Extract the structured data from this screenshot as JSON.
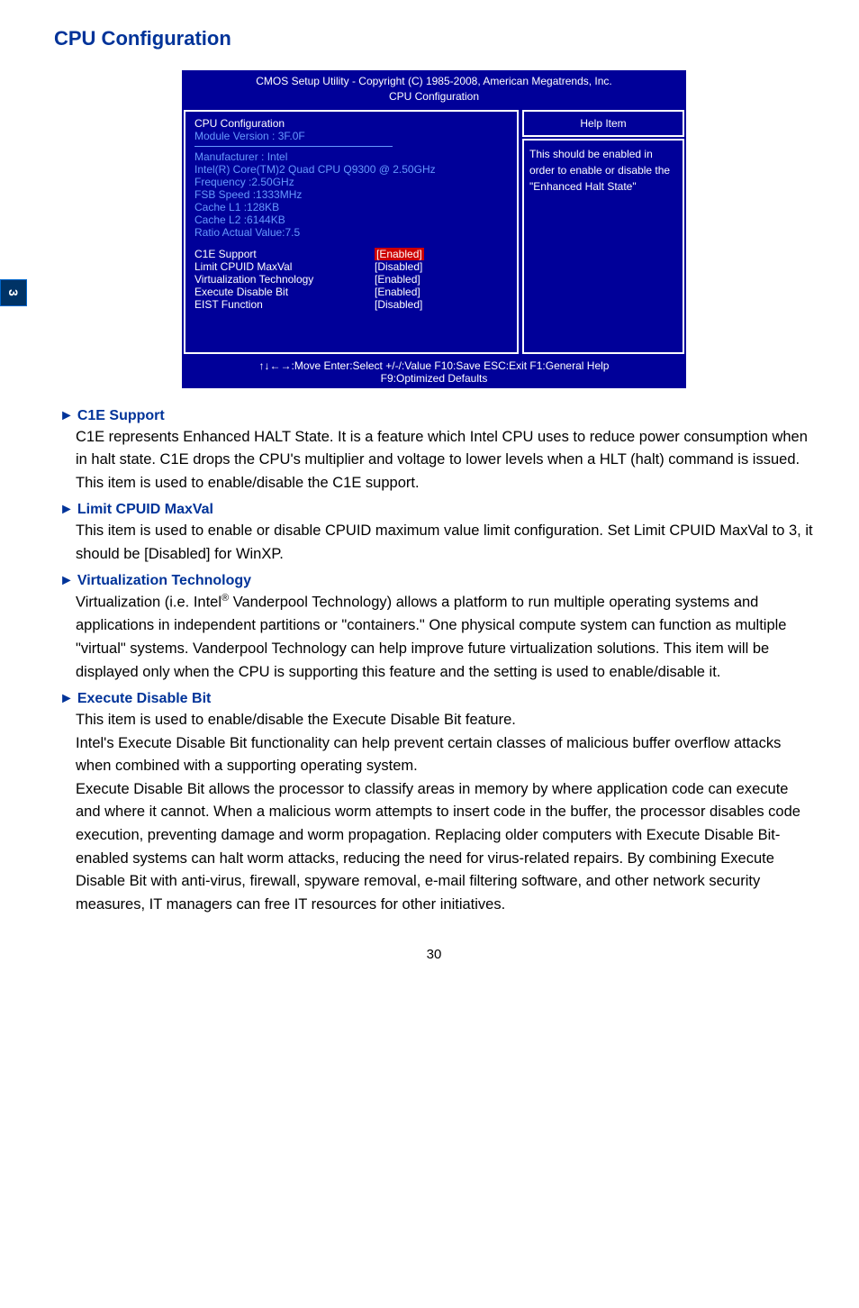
{
  "page": {
    "tab": "3",
    "title": "CPU Configuration",
    "pageNumber": "30"
  },
  "bios": {
    "header_line1": "CMOS Setup Utility - Copyright (C) 1985-2008, American Megatrends, Inc.",
    "header_line2": "CPU Configuration",
    "main": {
      "cfg_title": "CPU Configuration",
      "module_version": "Module Version :  3F.0F",
      "manufacturer": "Manufacturer : Intel",
      "cpu_name": "Intel(R) Core(TM)2 Quad CPU Q9300 @ 2.50GHz",
      "freq_label": "Frequency      :2.50GHz",
      "fsb_label": "FSB Speed    :1333MHz",
      "cache_l1": "Cache L1      :128KB",
      "cache_l2": "Cache L2      :6144KB",
      "ratio": "Ratio Actual Value:7.5",
      "options": [
        {
          "name": "c1e-support",
          "label": "C1E Support",
          "value": "[Enabled]",
          "highlighted": true
        },
        {
          "name": "limit-cpuid-maxval",
          "label": "Limit CPUID MaxVal",
          "value": "[Disabled]",
          "highlighted": false
        },
        {
          "name": "virtualization-technology",
          "label": "Virtualization Technology",
          "value": "[Enabled]",
          "highlighted": false
        },
        {
          "name": "execute-disable-bit",
          "label": "Execute Disable Bit",
          "value": "[Enabled]",
          "highlighted": false
        },
        {
          "name": "eist-function",
          "label": "EIST Function",
          "value": "[Disabled]",
          "highlighted": false
        }
      ]
    },
    "help": {
      "title": "Help Item",
      "body": "This should be enabled in order to enable or disable the \"Enhanced Halt State\""
    },
    "footer_line1": "↑↓←→:Move    Enter:Select      +/-/:Value      F10:Save      ESC:Exit      F1:General Help",
    "footer_line2": "F9:Optimized Defaults"
  },
  "items": {
    "c1e": {
      "header": "C1E Support",
      "arrow": "►",
      "body": "C1E represents Enhanced HALT State. It is a feature which Intel CPU uses to reduce power consumption when in halt state. C1E drops the CPU's multiplier and voltage to lower levels when a HLT (halt) command is issued. This item is used to enable/disable the C1E support."
    },
    "limit": {
      "header": "Limit CPUID MaxVal",
      "arrow": "►",
      "body": "This item is used to enable or disable CPUID maximum value limit configuration. Set Limit CPUID MaxVal to 3, it should be [Disabled] for WinXP."
    },
    "virt": {
      "header": "Virtualization Technology",
      "arrow": "►",
      "body_prefix": "Virtualization (i.e. Intel",
      "sup": "®",
      "body_suffix": " Vanderpool Technology) allows a platform to run multiple operating systems and applications in independent partitions or \"containers.\" One physical compute system can function as multiple \"virtual\" systems. Vanderpool Technology can help improve future virtualization solutions. This item will be displayed only when the CPU is supporting this feature and the setting is used to enable/disable it."
    },
    "exec": {
      "header": "Execute Disable Bit",
      "arrow": "►",
      "para1": "This item is used to enable/disable the Execute Disable Bit feature.",
      "para2": "Intel's Execute Disable Bit functionality can help prevent certain classes of malicious buffer overflow attacks when combined with a supporting operating system.",
      "para3": "Execute Disable Bit allows the processor to classify areas in memory by where application code can execute and where it cannot. When a malicious worm attempts to insert code in the buffer, the processor disables code execution, preventing damage and worm propagation. Replacing older computers with Execute Disable Bit-enabled systems can halt worm attacks, reducing the need for virus-related repairs. By combining Execute Disable Bit with anti-virus, firewall, spyware removal, e-mail filtering software, and other network security measures, IT managers can free IT resources for other initiatives."
    }
  }
}
